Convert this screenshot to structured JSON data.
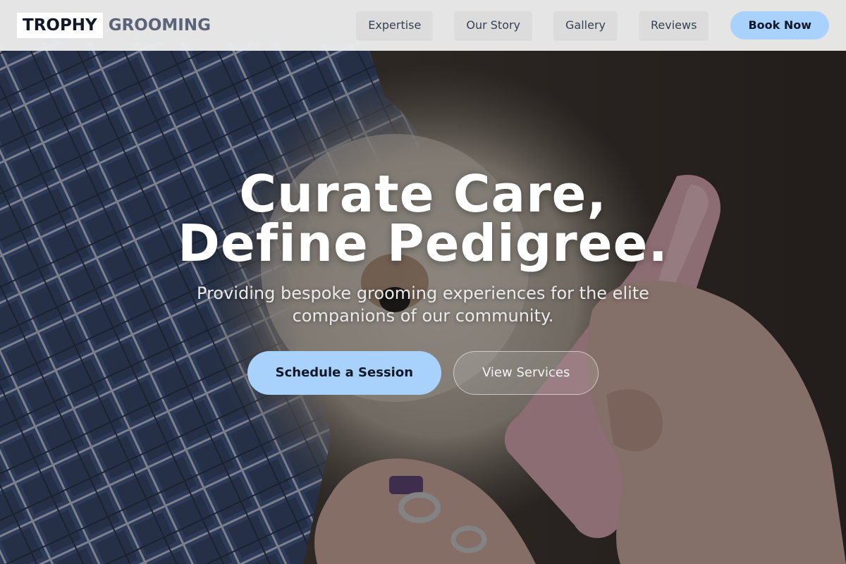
{
  "brand": {
    "part1": "TROPHY",
    "part2": "GROOMING"
  },
  "nav": {
    "links": [
      {
        "label": "Expertise"
      },
      {
        "label": "Our Story"
      },
      {
        "label": "Gallery"
      },
      {
        "label": "Reviews"
      }
    ],
    "cta_label": "Book Now"
  },
  "hero": {
    "headline_line1": "Curate Care,",
    "headline_line2": "Define Pedigree.",
    "subtitle": "Providing bespoke grooming experiences for the elite companions of our community.",
    "primary_cta": "Schedule a Session",
    "secondary_cta": "View Services",
    "background_image": "dog-being-groomed-photo"
  },
  "colors": {
    "accent": "#a8d1fb",
    "navbar_bg": "#ebebeb",
    "logo_dark": "#111827",
    "logo_muted": "#5b6478"
  }
}
